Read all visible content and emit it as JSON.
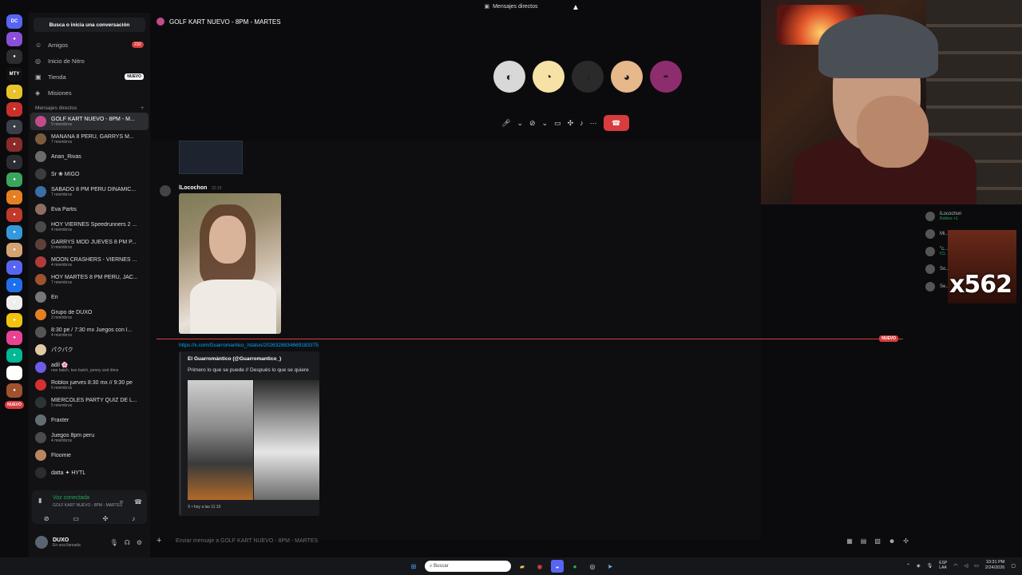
{
  "titlebar": {
    "title": "Mensajes directos"
  },
  "servers": [
    {
      "label": "DC",
      "color": "#5865f2",
      "badge": "232"
    },
    {
      "label": "●",
      "color": "#8a4fd8"
    },
    {
      "label": "●",
      "color": "#2b2d31"
    },
    {
      "label": "MTY",
      "color": "#111111"
    },
    {
      "label": "●",
      "color": "#e8c32a"
    },
    {
      "label": "●",
      "color": "#c9302c"
    },
    {
      "label": "●",
      "color": "#3a3f47"
    },
    {
      "label": "●",
      "color": "#8a2a2a"
    },
    {
      "label": "●",
      "color": "#2b2d31"
    },
    {
      "label": "●",
      "color": "#3ba55d"
    },
    {
      "label": "●",
      "color": "#e67e22"
    },
    {
      "label": "●",
      "color": "#c0392b"
    },
    {
      "label": "●",
      "color": "#3498db"
    },
    {
      "label": "●",
      "color": "#d4a373"
    },
    {
      "label": "●",
      "color": "#5865f2"
    },
    {
      "label": "●",
      "color": "#1f6feb"
    },
    {
      "label": "●",
      "color": "#eeeeee"
    },
    {
      "label": "●",
      "color": "#f1c40f"
    },
    {
      "label": "●",
      "color": "#e84393"
    },
    {
      "label": "●",
      "color": "#00b894"
    },
    {
      "label": "●",
      "color": "#ffffff"
    },
    {
      "label": "●",
      "color": "#a0522d"
    }
  ],
  "nuevo_label": "NUEVO",
  "search": {
    "label": "Busca o inicia una conversación"
  },
  "nav": [
    {
      "icon": "friends-icon",
      "glyph": "☺",
      "label": "Amigos",
      "count": "232"
    },
    {
      "icon": "nitro-icon",
      "glyph": "◎",
      "label": "Inicio de Nitro"
    },
    {
      "icon": "shop-icon",
      "glyph": "▣",
      "label": "Tienda",
      "tag": "NUEVO"
    },
    {
      "icon": "quests-icon",
      "glyph": "◈",
      "label": "Misiones"
    }
  ],
  "dm_header": {
    "label": "Mensajes directos",
    "add": "+"
  },
  "dms": [
    {
      "name": "GOLF KART NUEVO - 8PM - M...",
      "sub": "9 miembros",
      "color": "#c24b8a",
      "active": true
    },
    {
      "name": "MAÑANA 8 PERU, GARRYS M...",
      "sub": "7 miembros",
      "color": "#7a5c3c"
    },
    {
      "name": "Arian_Rivas",
      "sub": "",
      "color": "#6b6b6b"
    },
    {
      "name": "Sr  ❀ MIGO",
      "sub": "",
      "color": "#3c3c3c"
    },
    {
      "name": "SABADO 8 PM PERU DINAMIC...",
      "sub": "7 miembros",
      "color": "#3a6ea5"
    },
    {
      "name": "Eva Partis",
      "sub": "",
      "color": "#8d6e63"
    },
    {
      "name": "HOY VIERNES Speedrunners 2 ...",
      "sub": "4 miembros",
      "color": "#4a4a4a"
    },
    {
      "name": "GARRYS MOD JUEVES 8 PM P...",
      "sub": "9 miembros",
      "color": "#5d4037"
    },
    {
      "name": "MOON CRASHERS - VIERNES ...",
      "sub": "4 miembros",
      "color": "#b23a3a"
    },
    {
      "name": "HOY MARTES 8 PM PERU, JAC...",
      "sub": "7 miembros",
      "color": "#a0522d"
    },
    {
      "name": "Eri",
      "sub": "",
      "color": "#777777"
    },
    {
      "name": "Grupo de DUXO",
      "sub": "3 miembros",
      "color": "#e67e22"
    },
    {
      "name": "8:30 pe / 7:30 mx Juegos con l...",
      "sub": "4 miembros",
      "color": "#555555"
    },
    {
      "name": "パクパク",
      "sub": "",
      "color": "#e0c9a6"
    },
    {
      "name": "adil 🌸",
      "sub": "one batch, two batch, penny and dime",
      "color": "#6c5ce7"
    },
    {
      "name": "Roblox jueves 8:30 mx // 9:30 pe",
      "sub": "6 miembros",
      "color": "#d63031"
    },
    {
      "name": "MIERCOLES PARTY QUIZ DE L...",
      "sub": "5 miembros",
      "color": "#2d3436"
    },
    {
      "name": "Fraxter",
      "sub": "",
      "color": "#636e72"
    },
    {
      "name": "Juegos 8pm peru",
      "sub": "4 miembros",
      "color": "#4b4b4b"
    },
    {
      "name": "Floomie",
      "sub": "",
      "color": "#b8875f"
    },
    {
      "name": "datta  ✦ HYTL",
      "sub": "",
      "color": "#2d2d2d"
    }
  ],
  "voice": {
    "title": "Voz conectada",
    "channel": "GOLF KART NUEVO - 8PM - MARTES"
  },
  "voice_buttons": [
    {
      "name": "camera-off-icon",
      "glyph": "⊘"
    },
    {
      "name": "screen-share-icon",
      "glyph": "▭"
    },
    {
      "name": "activities-icon",
      "glyph": "✣"
    },
    {
      "name": "soundboard-icon",
      "glyph": "♪"
    }
  ],
  "user": {
    "name": "DUXO",
    "status": "En una llamada"
  },
  "call": {
    "title": "GOLF KART NUEVO - 8PM - MARTES"
  },
  "participants": [
    {
      "color": "#d8d8d8",
      "glyph": "◐"
    },
    {
      "color": "#f6e2a6",
      "glyph": "◔"
    },
    {
      "color": "#2a2a2a",
      "glyph": "◑"
    },
    {
      "color": "#e6b88a",
      "glyph": "◕"
    },
    {
      "color": "#8e2d6e",
      "glyph": "◓"
    }
  ],
  "message": {
    "author": "lLocochon",
    "time": "22:15"
  },
  "new_divider": "NUEVO",
  "link": "https://x.com/Guarromantico_/status/2026328834669183375",
  "embed": {
    "title": "El Guarromántico (@Guarromantico_)",
    "text": "Primero lo que se puede // Después lo que se quiere",
    "footer": "X • hoy a las 11:10"
  },
  "composer": {
    "placeholder": "Enviar mensaje a GOLF KART NUEVO - 8PM - MARTES"
  },
  "side_voice": [
    {
      "name": "lLocochon",
      "sub": "Roblox +1"
    },
    {
      "name": "Mi...",
      "sub": ""
    },
    {
      "name": "\"c...",
      "sub": "ICL"
    },
    {
      "name": "So...",
      "sub": ""
    },
    {
      "name": "Se...",
      "sub": ""
    }
  ],
  "overlay_text": "x562",
  "taskbar": {
    "search": "Buscar",
    "lang": "ESP\nLAA",
    "time": "10:31 PM",
    "date": "2/24/2026"
  }
}
